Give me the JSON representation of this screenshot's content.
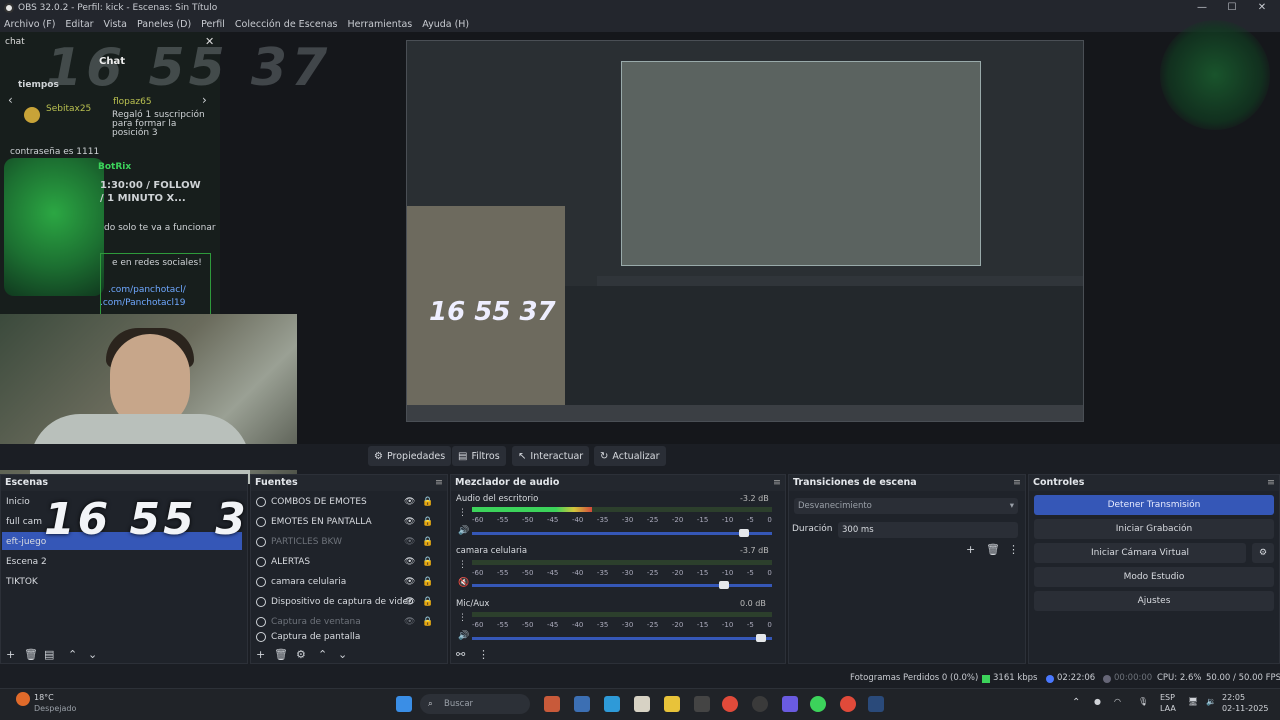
{
  "window": {
    "title": "OBS 32.0.2 - Perfil: kick - Escenas: Sin Título",
    "controls": [
      "—",
      "☐",
      "✕"
    ]
  },
  "menu": [
    "Archivo (F)",
    "Editar",
    "Vista",
    "Paneles (D)",
    "Perfil",
    "Colección de Escenas",
    "Herramientas",
    "Ayuda (H)"
  ],
  "preview": {
    "chat": {
      "tab": "chat",
      "close": "✕",
      "header": "Chat",
      "tiempos": "tiempos",
      "user1": "Sebitax25",
      "user2": "flopaz65",
      "gift_text1": "Regaló 1 suscripción",
      "gift_text2": "para formar la",
      "gift_text3": "posición 3",
      "line_contrasena": "contraseña es 1111",
      "bot": "BotRix",
      "follow1": "1:30:00 / FOLLOW",
      "follow2": "/ 1 MINUTO X...",
      "line_funcionar": "do solo te va a funcionar",
      "line_redes": "e en redes sociales!",
      "link1": ".com/panchotacl/",
      "link2": ".com/Panchotacl19"
    },
    "clock": "16 55 37"
  },
  "toolbar": {
    "properties": "Propiedades",
    "filters": "Filtros",
    "interact": "Interactuar",
    "refresh": "Actualizar"
  },
  "scenes": {
    "title": "Escenas",
    "items": [
      "Inicio",
      "full cam",
      "eft-juego",
      "Escena 2",
      "TIKTOK"
    ]
  },
  "sources": {
    "title": "Fuentes",
    "items": [
      "COMBOS DE EMOTES",
      "EMOTES EN PANTALLA",
      "PARTICLES BKW",
      "ALERTAS",
      "camara celularia",
      "Dispositivo de captura de video",
      "Captura de ventana",
      "Captura de pantalla"
    ]
  },
  "mixer": {
    "title": "Mezclador de audio",
    "channels": [
      {
        "name": "Audio del escritorio",
        "db": "-3.2 dB",
        "level": 0.4,
        "volume": 0.92
      },
      {
        "name": "camara celularia",
        "db": "-3.7 dB",
        "level": 0.0,
        "volume": 0.85
      },
      {
        "name": "Mic/Aux",
        "db": "0.0 dB",
        "level": 0.0,
        "volume": 0.98
      }
    ],
    "scale": [
      "-60",
      "-55",
      "-50",
      "-45",
      "-40",
      "-35",
      "-30",
      "-25",
      "-20",
      "-15",
      "-10",
      "-5",
      "0"
    ]
  },
  "transitions": {
    "title": "Transiciones de escena",
    "selected": "Desvanecimiento",
    "duration_label": "Duración",
    "duration": "300 ms"
  },
  "controls": {
    "title": "Controles",
    "stop_stream": "Detener Transmisión",
    "start_recording": "Iniciar Grabación",
    "virtual_cam": "Iniciar Cámara Virtual",
    "studio_mode": "Modo Estudio",
    "settings": "Ajustes"
  },
  "status": {
    "dropped": "Fotogramas Perdidos 0 (0.0%)",
    "bitrate": "3161 kbps",
    "stream_time": "02:22:06",
    "rec_time": "00:00:00",
    "cpu": "CPU: 2.6%",
    "fps": "50.00 / 50.00 FPS"
  },
  "taskbar": {
    "weather_temp": "18°C",
    "weather_desc": "Despejado",
    "search": "Buscar",
    "lang1": "ESP",
    "lang2": "LAA",
    "time": "22:05",
    "date": "02-11-2025"
  }
}
